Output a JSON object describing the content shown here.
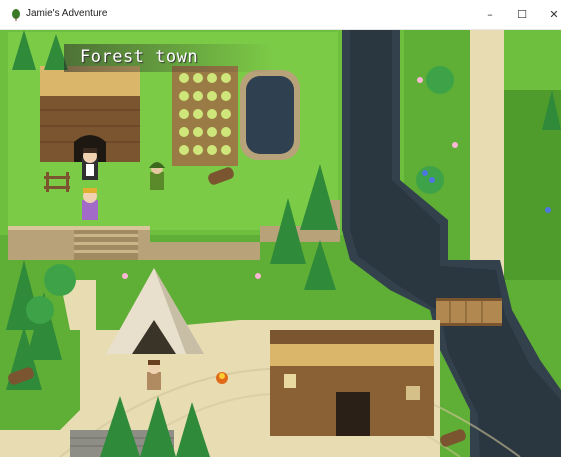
{
  "window": {
    "title": "Jamie's Adventure",
    "icon": "leaf-app-icon",
    "controls": {
      "minimize": "–",
      "maximize": "☐",
      "close": "✕"
    }
  },
  "game": {
    "location_name": "Forest town",
    "player_sprite": "maid-character",
    "party_sprite": "purple-girl-character",
    "npcs": [
      "green-hooded-villager",
      "brown-haired-villager"
    ]
  },
  "colors": {
    "grass": "#6fbf3e",
    "dark_grass": "#4f9c2c",
    "path": "#e8dcb2",
    "water": "#33414d",
    "cliff": "#b8a27a",
    "wood": "#7a5530",
    "roof": "#d9b66a"
  }
}
